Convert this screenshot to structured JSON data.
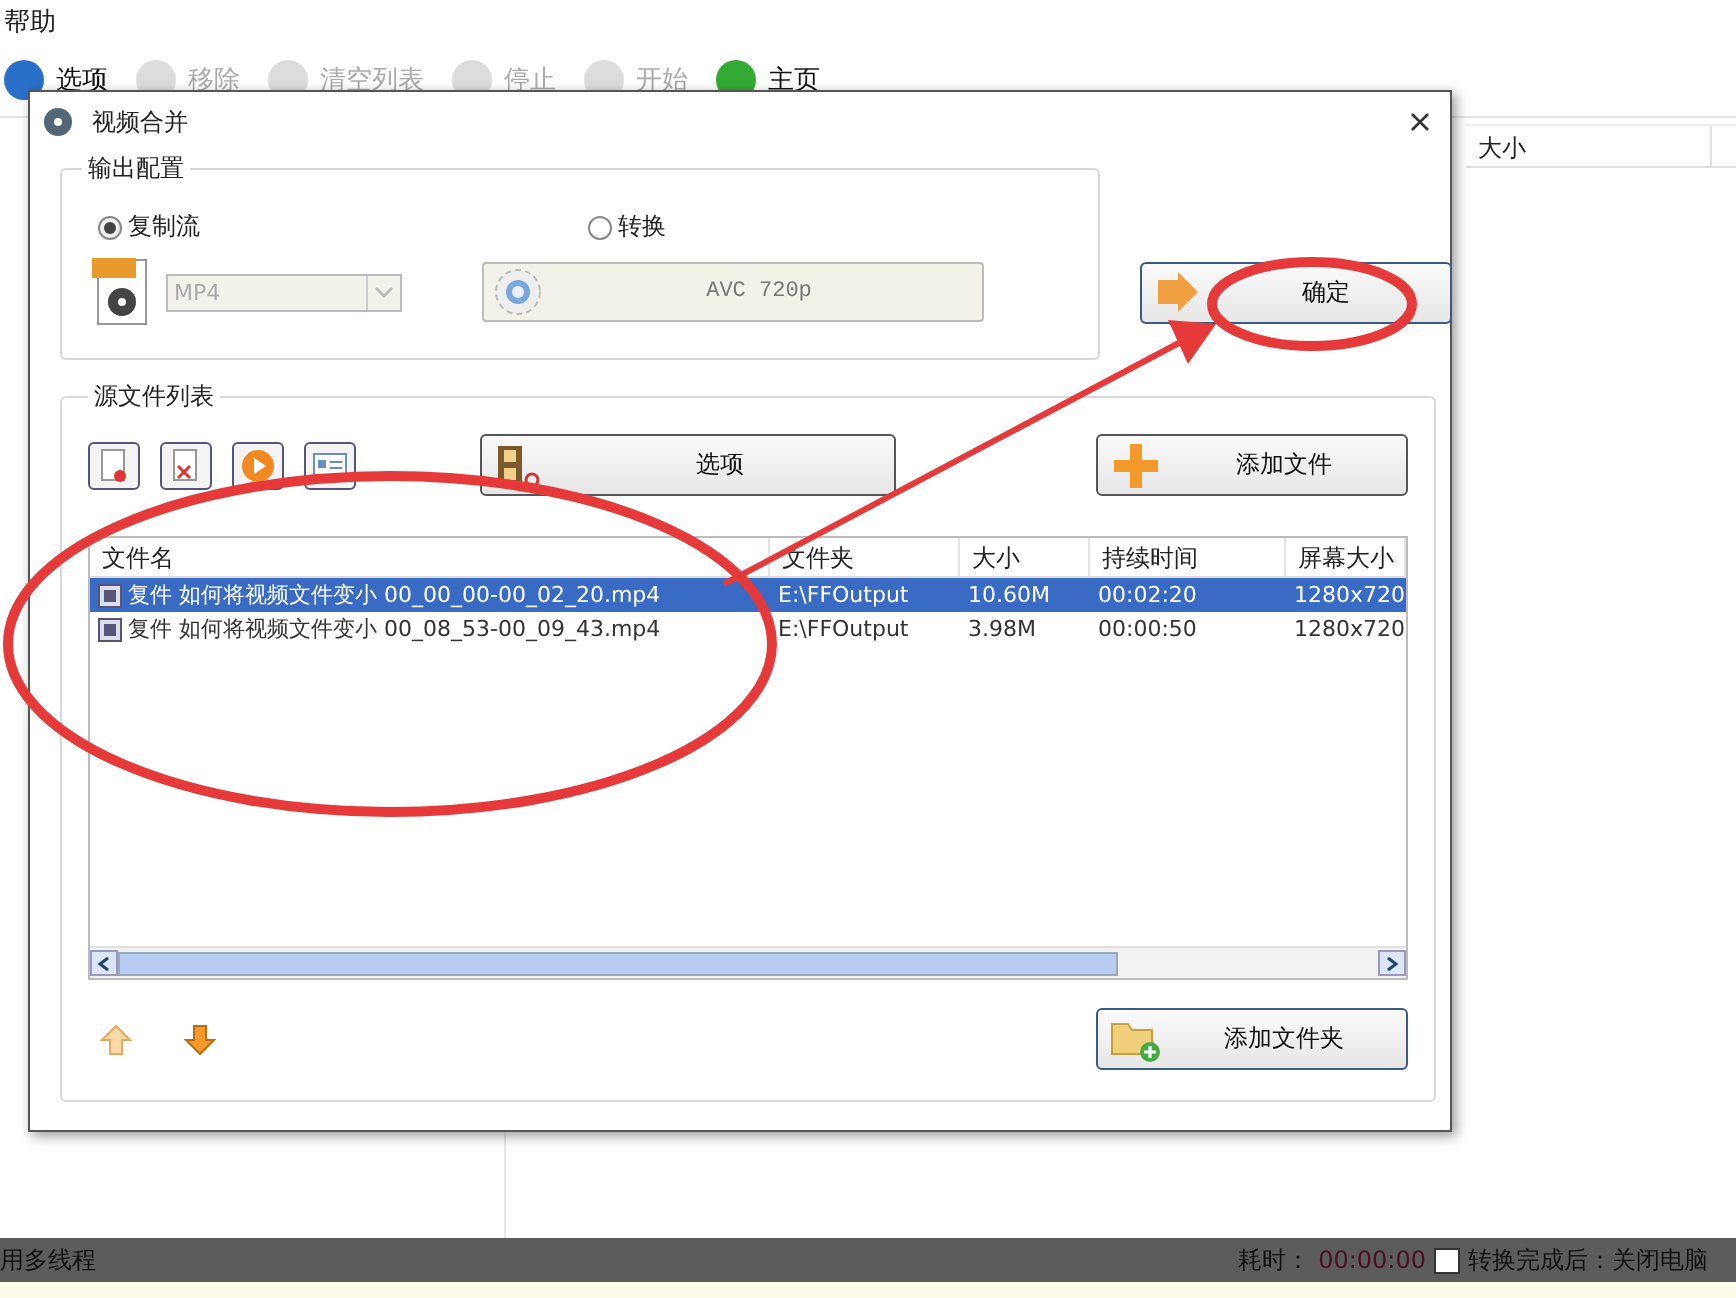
{
  "menu": [
    {
      "label": "帮助"
    }
  ],
  "toolbar": [
    {
      "label": "选项",
      "disabled": false
    },
    {
      "label": "移除",
      "disabled": true
    },
    {
      "label": "清空列表",
      "disabled": true
    },
    {
      "label": "停止",
      "disabled": true
    },
    {
      "label": "开始",
      "disabled": true
    },
    {
      "label": "主页",
      "disabled": false
    }
  ],
  "background_table": {
    "columns": [
      "大小"
    ]
  },
  "dialog": {
    "title": "视频合并",
    "output_group": {
      "title": "输出配置",
      "modes": [
        {
          "label": "复制流",
          "selected": true
        },
        {
          "label": "转换",
          "selected": false
        }
      ],
      "format": {
        "value": "MP4",
        "disabled": true
      },
      "preset": {
        "label": "AVC 720p",
        "disabled": true
      }
    },
    "ok_button": "确定",
    "source_group": {
      "title": "源文件列表",
      "options_button": "选项",
      "add_file_button": "添加文件",
      "columns": [
        "文件名",
        "文件夹",
        "大小",
        "持续时间",
        "屏幕大小"
      ],
      "rows": [
        {
          "selected": true,
          "cells": [
            "复件 如何将视频文件变小 00_00_00-00_02_20.mp4",
            "E:\\FFOutput",
            "10.60M",
            "00:02:20",
            "1280x720"
          ]
        },
        {
          "selected": false,
          "cells": [
            "复件 如何将视频文件变小 00_08_53-00_09_43.mp4",
            "E:\\FFOutput",
            "3.98M",
            "00:00:50",
            "1280x720"
          ]
        }
      ],
      "add_folder_button": "添加文件夹"
    }
  },
  "status_bar": {
    "left": "用多线程",
    "elapsed_label": "耗时：",
    "elapsed": "00:00:00",
    "shutdown": {
      "checked": false,
      "label": "转换完成后：关闭电脑"
    }
  }
}
